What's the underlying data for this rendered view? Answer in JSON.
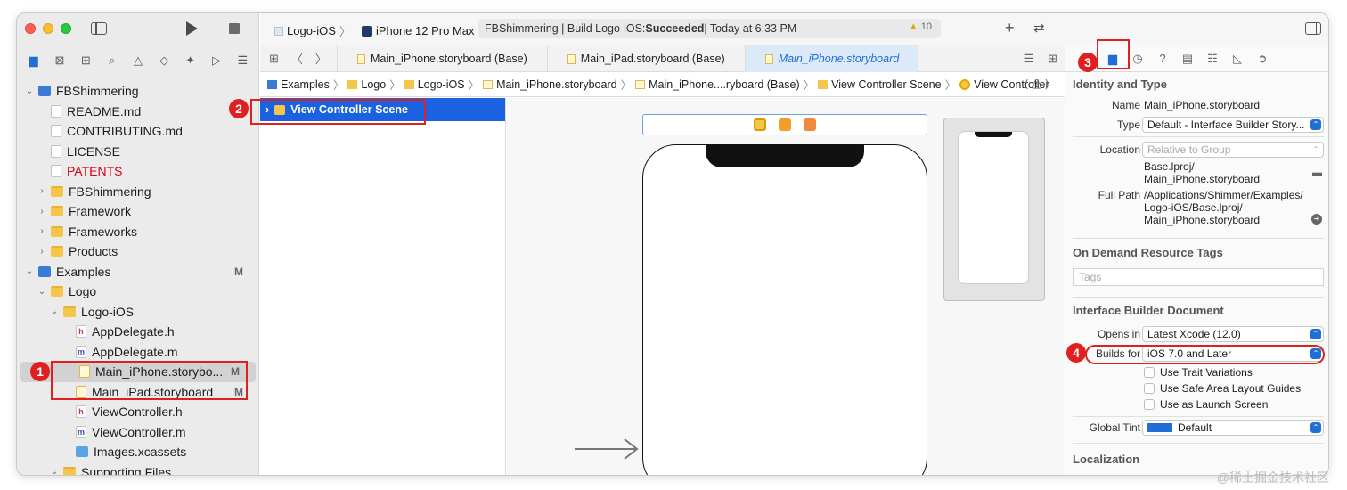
{
  "toolbar": {
    "scheme": "Logo-iOS",
    "device": "iPhone 12 Pro Max",
    "status_prefix": "FBShimmering | Build Logo-iOS: ",
    "status_result": "Succeeded",
    "status_suffix": " | Today at 6:33 PM",
    "warnings": "10",
    "icons": {
      "run": "play-icon",
      "stop": "stop-icon",
      "add": "plus-icon",
      "swap": "swap-icon"
    }
  },
  "navigator": {
    "icons": [
      "folder-icon",
      "source-control-icon",
      "symbol-icon",
      "search-icon",
      "issue-icon",
      "test-icon",
      "debug-icon",
      "breakpoint-icon",
      "report-icon"
    ],
    "items": [
      {
        "label": "FBShimmering",
        "icon": "project",
        "level": 0,
        "chev": "v"
      },
      {
        "label": "README.md",
        "icon": "doc",
        "level": 1
      },
      {
        "label": "CONTRIBUTING.md",
        "icon": "doc",
        "level": 1
      },
      {
        "label": "LICENSE",
        "icon": "doc",
        "level": 1
      },
      {
        "label": "PATENTS",
        "icon": "doc",
        "level": 1,
        "red": true
      },
      {
        "label": "FBShimmering",
        "icon": "folder",
        "level": 1,
        "chev": ">"
      },
      {
        "label": "Framework",
        "icon": "folder",
        "level": 1,
        "chev": ">"
      },
      {
        "label": "Frameworks",
        "icon": "folder",
        "level": 1,
        "chev": ">"
      },
      {
        "label": "Products",
        "icon": "folder",
        "level": 1,
        "chev": ">"
      },
      {
        "label": "Examples",
        "icon": "project",
        "level": 0,
        "chev": "v",
        "badge": "M"
      },
      {
        "label": "Logo",
        "icon": "folder",
        "level": 1,
        "chev": "v"
      },
      {
        "label": "Logo-iOS",
        "icon": "folder",
        "level": 2,
        "chev": "v"
      },
      {
        "label": "AppDelegate.h",
        "icon": "h",
        "level": 3
      },
      {
        "label": "AppDelegate.m",
        "icon": "m",
        "level": 3
      },
      {
        "label": "Main_iPhone.storybo...",
        "icon": "sb",
        "level": 3,
        "badge": "M",
        "selected": true
      },
      {
        "label": "Main_iPad.storyboard",
        "icon": "sb",
        "level": 3,
        "badge": "M"
      },
      {
        "label": "ViewController.h",
        "icon": "h",
        "level": 3
      },
      {
        "label": "ViewController.m",
        "icon": "m",
        "level": 3
      },
      {
        "label": "Images.xcassets",
        "icon": "assets",
        "level": 3
      },
      {
        "label": "Supporting Files",
        "icon": "folder",
        "level": 2,
        "chev": "v"
      }
    ]
  },
  "tabs": [
    {
      "label": "Main_iPhone.storyboard (Base)",
      "active": false
    },
    {
      "label": "Main_iPad.storyboard (Base)",
      "active": false
    },
    {
      "label": "Main_iPhone.storyboard",
      "active": true
    }
  ],
  "jumpbar": [
    "Examples",
    "Logo",
    "Logo-iOS",
    "Main_iPhone.storyboard",
    "Main_iPhone....ryboard (Base)",
    "View Controller Scene",
    "View Controller"
  ],
  "outline": {
    "scene": "View Controller Scene"
  },
  "inspector": {
    "identity_title": "Identity and Type",
    "name_label": "Name",
    "name_value": "Main_iPhone.storyboard",
    "type_label": "Type",
    "type_value": "Default - Interface Builder Story...",
    "location_label": "Location",
    "location_value": "Relative to Group",
    "location_path1": "Base.lproj/",
    "location_path2": "Main_iPhone.storyboard",
    "fullpath_label": "Full Path",
    "fullpath_1": "/Applications/Shimmer/Examples/",
    "fullpath_2": "Logo-iOS/Base.lproj/",
    "fullpath_3": "Main_iPhone.storyboard",
    "tags_title": "On Demand Resource Tags",
    "tags_placeholder": "Tags",
    "ib_title": "Interface Builder Document",
    "opens_label": "Opens in",
    "opens_value": "Latest Xcode (12.0)",
    "builds_label": "Builds for",
    "builds_value": "iOS 7.0 and Later",
    "cb_trait": "Use Trait Variations",
    "cb_safe": "Use Safe Area Layout Guides",
    "cb_launch": "Use as Launch Screen",
    "tint_label": "Global Tint",
    "tint_value": "Default",
    "loc_title": "Localization"
  },
  "annotations": [
    "1",
    "2",
    "3",
    "4"
  ],
  "watermark": "@稀土掘金技术社区"
}
